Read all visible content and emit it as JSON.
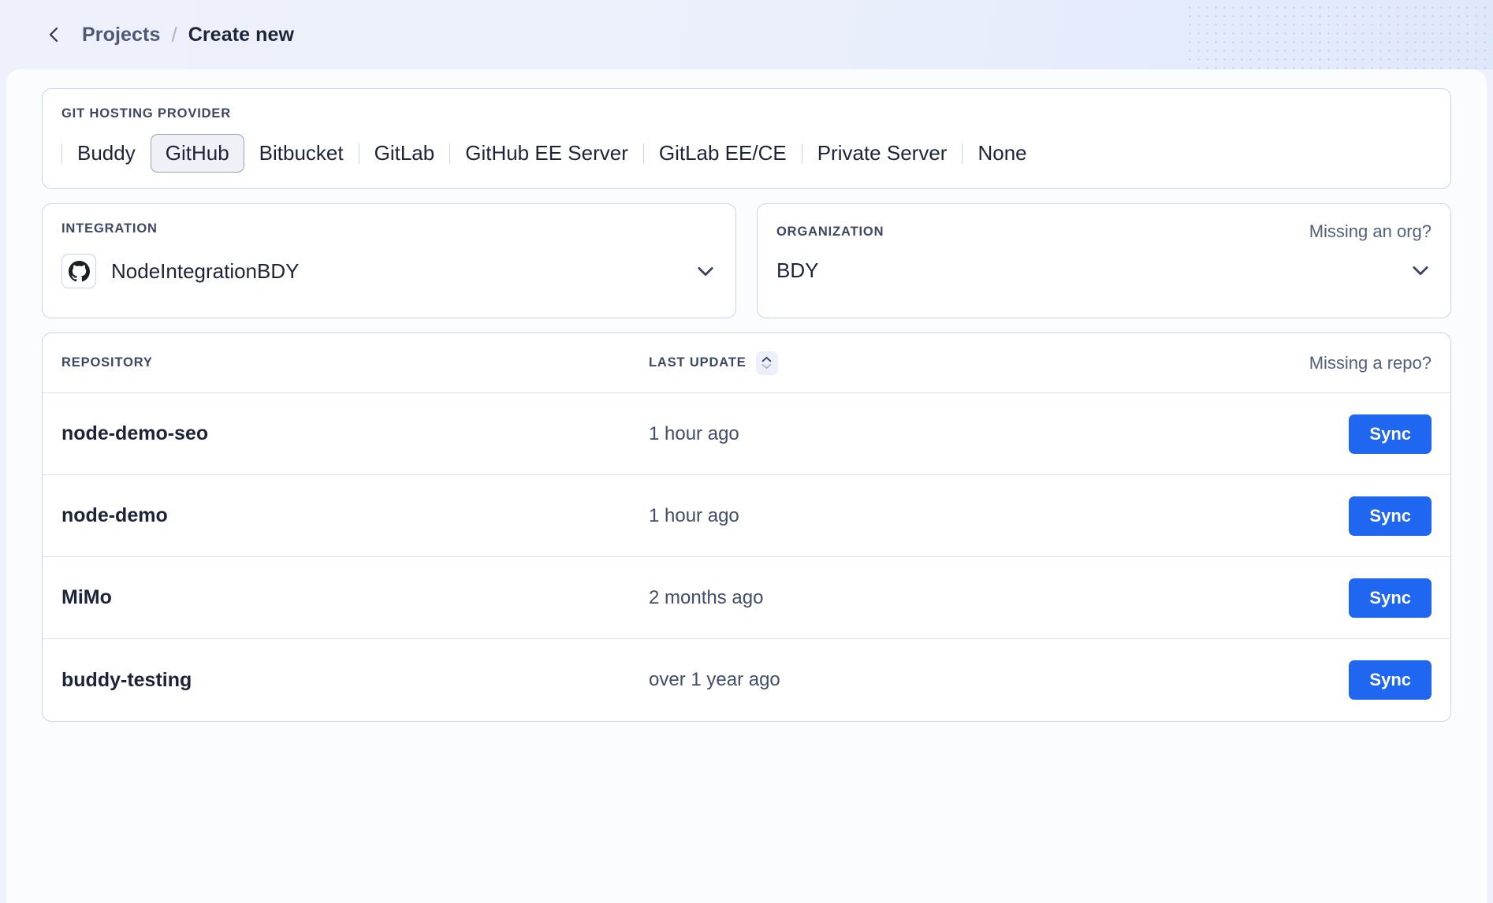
{
  "header": {
    "back_icon": "chevron-left-icon",
    "breadcrumb_root": "Projects",
    "breadcrumb_separator": "/",
    "breadcrumb_current": "Create new"
  },
  "provider": {
    "label": "GIT HOSTING PROVIDER",
    "selected": "GitHub",
    "tabs": [
      {
        "label": "Buddy",
        "selected": false
      },
      {
        "label": "GitHub",
        "selected": true
      },
      {
        "label": "Bitbucket",
        "selected": false
      },
      {
        "label": "GitLab",
        "selected": false
      },
      {
        "label": "GitHub EE Server",
        "selected": false
      },
      {
        "label": "GitLab EE/CE",
        "selected": false
      },
      {
        "label": "Private Server",
        "selected": false
      },
      {
        "label": "None",
        "selected": false
      }
    ]
  },
  "integration": {
    "label": "INTEGRATION",
    "icon": "github-icon",
    "value": "NodeIntegrationBDY",
    "chevron": "chevron-down-icon"
  },
  "organization": {
    "label": "ORGANIZATION",
    "help_link": "Missing an org?",
    "value": "BDY",
    "chevron": "chevron-down-icon"
  },
  "repositories": {
    "col_repository": "REPOSITORY",
    "col_last_update": "LAST UPDATE",
    "sort_icon": "sort-ascending-icon",
    "help_link": "Missing a repo?",
    "action_label": "Sync",
    "rows": [
      {
        "name": "node-demo-seo",
        "updated": "1 hour ago",
        "action": "Sync"
      },
      {
        "name": "node-demo",
        "updated": "1 hour ago",
        "action": "Sync"
      },
      {
        "name": "MiMo",
        "updated": "2 months ago",
        "action": "Sync"
      },
      {
        "name": "buddy-testing",
        "updated": "over 1 year ago",
        "action": "Sync"
      }
    ]
  },
  "colors": {
    "accent": "#1f66f0",
    "page_background": "#eef1fb",
    "card_border": "#c9d6ef",
    "text_primary": "#1d2439",
    "text_muted": "#4c5878"
  }
}
